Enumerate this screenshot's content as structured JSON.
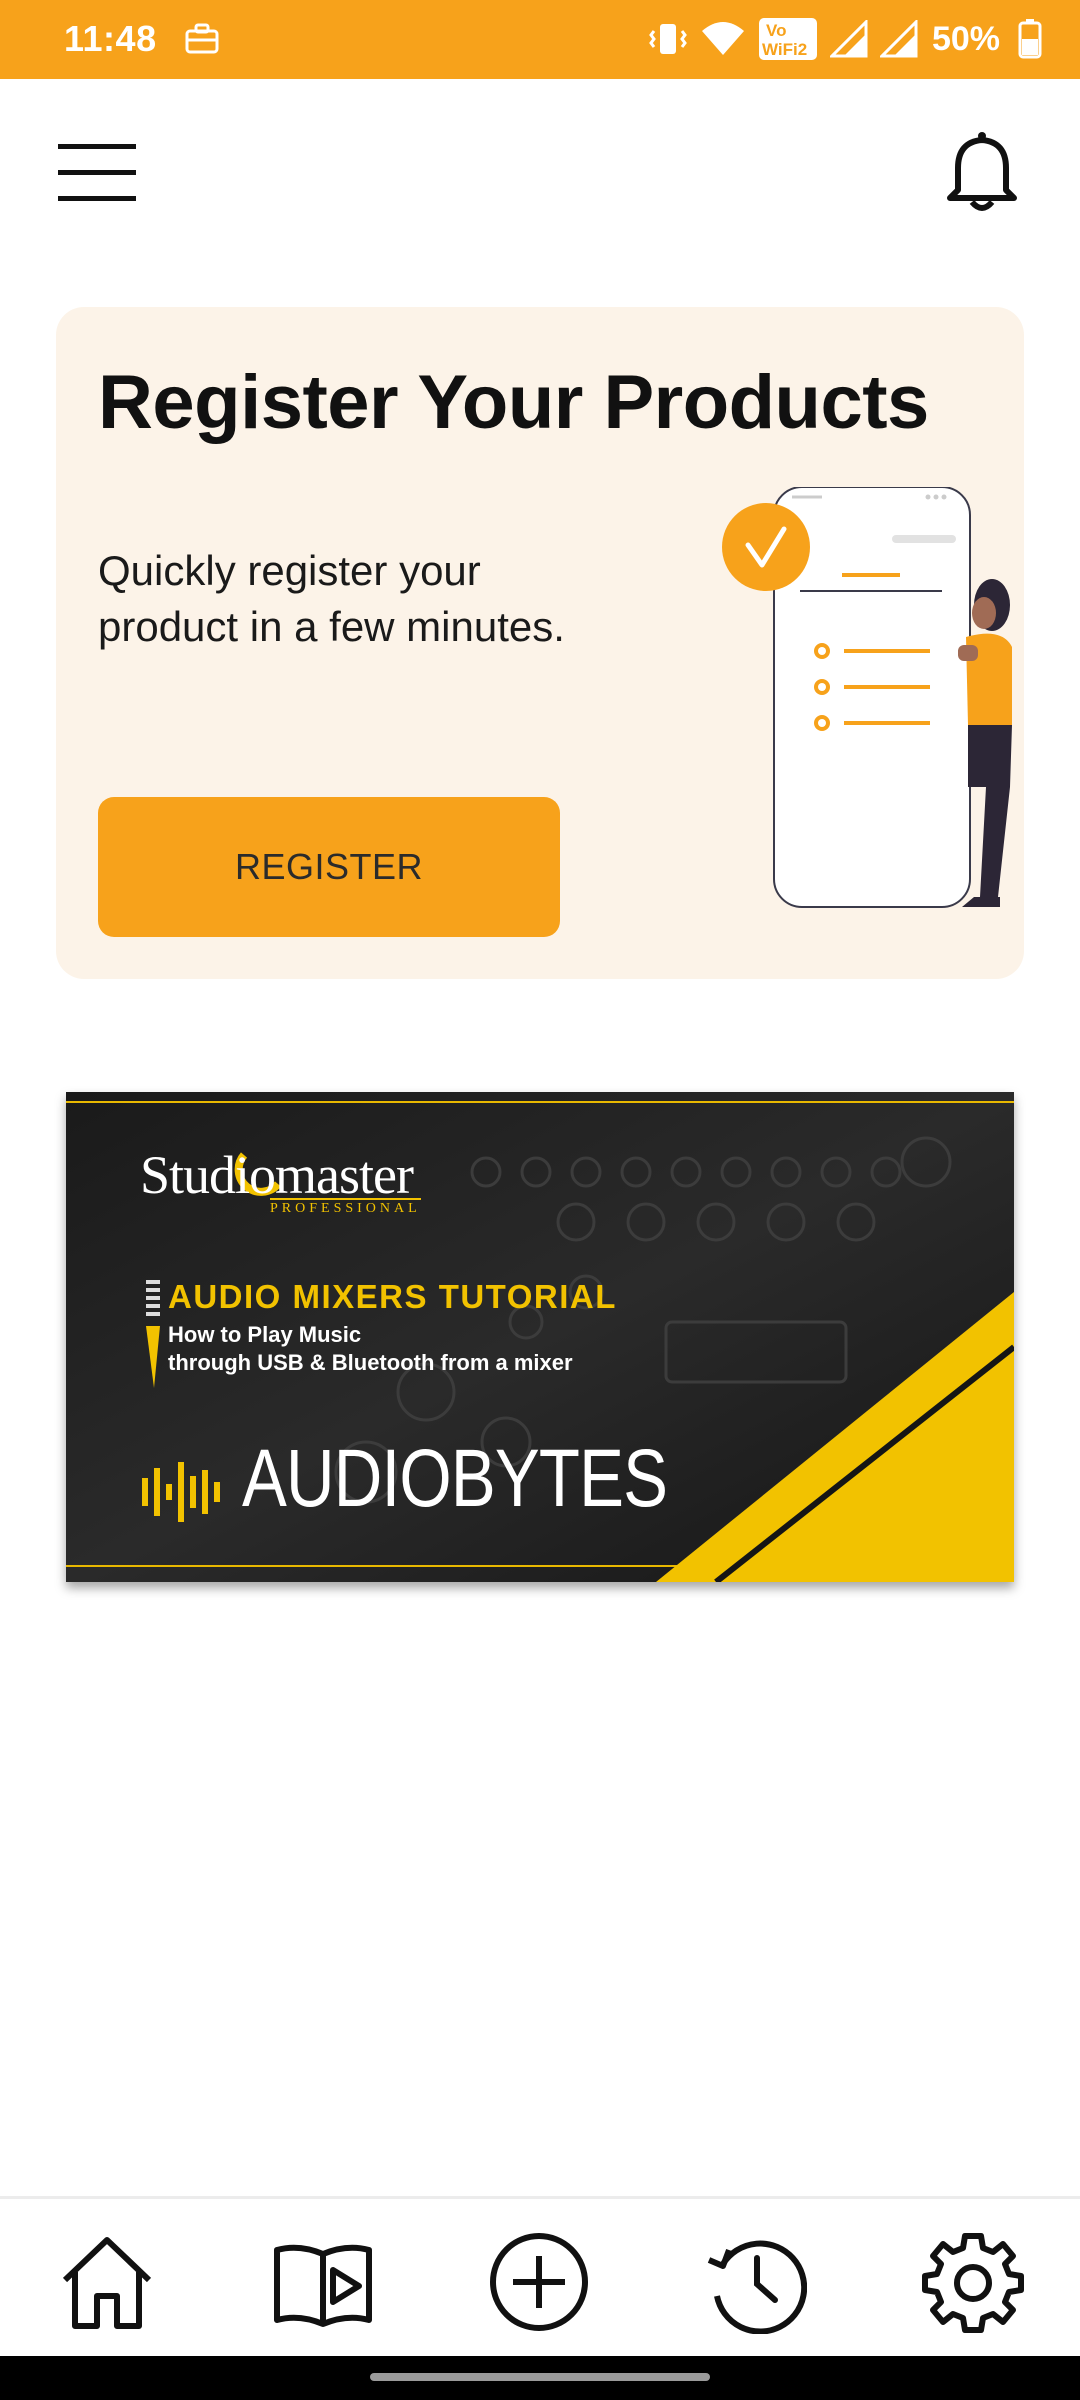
{
  "status_bar": {
    "time": "11:48",
    "battery": "50%",
    "icons": [
      "briefcase-icon",
      "vibrate-icon",
      "wifi-icon",
      "vowifi-icon",
      "signal-icon",
      "signal-icon",
      "battery-icon"
    ],
    "vowifi_top": "Vo",
    "vowifi_bottom": "WiFi2",
    "color": "#F7A21B"
  },
  "header": {
    "menu_icon": "hamburger-icon",
    "notification_icon": "bell-icon"
  },
  "register_card": {
    "title": "Register Your Products",
    "description": "Quickly register your product in a few minutes.",
    "button_label": "REGISTER",
    "background": "#FCF3E8",
    "accent": "#F7A21B",
    "illustration": "phone-checklist-illustration"
  },
  "banner": {
    "logo": "Studiomaster",
    "logo_sub": "PROFESSIONAL",
    "heading": "AUDIO MIXERS TUTORIAL",
    "subheading_line1": "How to Play Music",
    "subheading_line2": "through USB & Bluetooth from a mixer",
    "brand": "AUDIOBYTES",
    "accent": "#F2C200"
  },
  "bottom_nav": {
    "items": [
      {
        "icon": "home-icon"
      },
      {
        "icon": "video-book-icon"
      },
      {
        "icon": "add-circle-icon"
      },
      {
        "icon": "history-icon"
      },
      {
        "icon": "settings-icon"
      }
    ]
  }
}
